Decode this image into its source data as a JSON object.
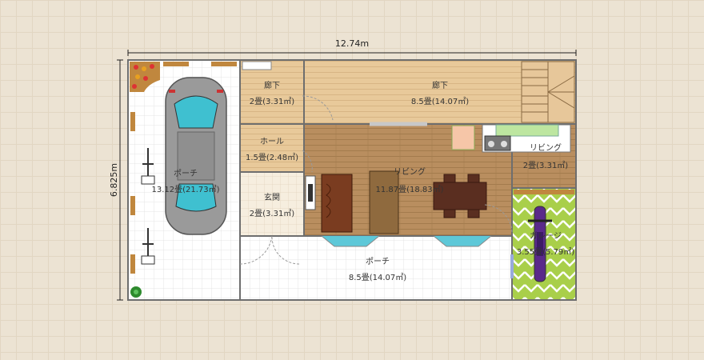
{
  "dimensions": {
    "width_label": "12.74m",
    "height_label": "6.825m"
  },
  "rooms": {
    "porch_left": {
      "name": "ポーチ",
      "area": "13.12畳(21.73㎡)"
    },
    "hall_top": {
      "name": "廊下",
      "area": "2畳(3.31㎡)"
    },
    "hall_big": {
      "name": "廊下",
      "area": "8.5畳(14.07㎡)"
    },
    "hall_room": {
      "name": "ホール",
      "area": "1.5畳(2.48㎡)"
    },
    "entrance": {
      "name": "玄関",
      "area": "2畳(3.31㎡)"
    },
    "living": {
      "name": "リビング",
      "area": "11.87畳(18.83㎡)"
    },
    "living_small": {
      "name": "リビング",
      "area": "2畳(3.31㎡)"
    },
    "porch_bottom": {
      "name": "ポーチ",
      "area": "8.5畳(14.07㎡)"
    },
    "garage": {
      "name": "ガレージ",
      "area": "3.55畳(5.79㎡)"
    }
  },
  "colors": {
    "wall": "#6e6e6e",
    "wood_floor": "#e6c89a",
    "dark_wood_floor": "#b98c5c",
    "tile_floor": "#ffffff",
    "garage_floor": "#9bc13c",
    "car_body": "#9a9a9a",
    "car_glass": "#3fc0d0",
    "sink_counter": "#bde6a0"
  },
  "icons": [
    "car-icon",
    "bicycle-icon",
    "motorcycle-icon",
    "stairs-icon",
    "dining-table-icon",
    "sofa-icon",
    "tv-icon",
    "kitchen-icon",
    "plant-icon"
  ]
}
